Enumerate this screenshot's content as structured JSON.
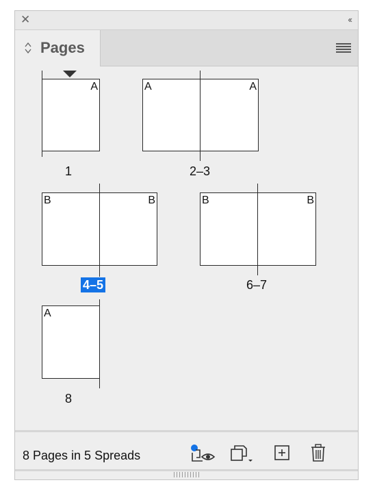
{
  "panel": {
    "close_glyph": "✕",
    "collapse_glyph": "‹‹",
    "tab_label": "Pages"
  },
  "pages": {
    "single_1": {
      "caption": "1",
      "master": "A"
    },
    "spread_2_3": {
      "caption": "2–3",
      "left_master": "A",
      "right_master": "A"
    },
    "spread_4_5": {
      "caption": "4–5",
      "left_master": "B",
      "right_master": "B",
      "selected": true
    },
    "spread_6_7": {
      "caption": "6–7",
      "left_master": "B",
      "right_master": "B"
    },
    "single_8": {
      "caption": "8",
      "master": "A"
    }
  },
  "footer": {
    "status": "8 Pages in 5 Spreads"
  },
  "colors": {
    "selection": "#1473e6",
    "panel_bg": "#eeeeee",
    "page_bg": "#ffffff"
  },
  "icons": [
    "close-icon",
    "collapse-icon",
    "panel-menu-icon",
    "edit-page-size-icon",
    "new-page-icon",
    "trash-icon"
  ]
}
